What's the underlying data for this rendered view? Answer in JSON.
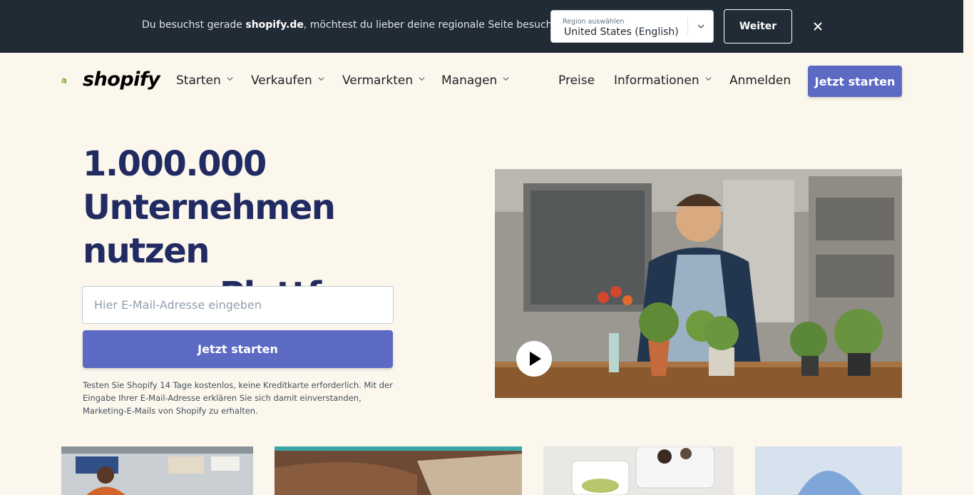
{
  "region_banner": {
    "text_before": "Du besuchst gerade ",
    "domain": "shopify.de",
    "text_after": ", möchtest du lieber deine regionale Seite besuchen?",
    "select_label": "Region auswählen",
    "select_value": "United States (English)",
    "continue_label": "Weiter",
    "close_icon": "close-icon"
  },
  "nav": {
    "logo_text": "shopify",
    "items": [
      {
        "label": "Starten",
        "dropdown": true
      },
      {
        "label": "Verkaufen",
        "dropdown": true
      },
      {
        "label": "Vermarkten",
        "dropdown": true
      },
      {
        "label": "Managen",
        "dropdown": true
      },
      {
        "label": "Preise",
        "dropdown": false
      },
      {
        "label": "Informationen",
        "dropdown": true
      },
      {
        "label": "Anmelden",
        "dropdown": false
      }
    ],
    "cta_label": "Jetzt starten"
  },
  "hero": {
    "title_line1": "1.000.000",
    "title_line2": "Unternehmen nutzen",
    "title_line3": "unsere Plattform",
    "email_placeholder": "Hier E-Mail-Adresse eingeben",
    "cta_label": "Jetzt starten",
    "fineprint": "Testen Sie Shopify 14 Tage kostenlos, keine Kreditkarte erforderlich. Mit der Eingabe Ihrer E-Mail-Adresse erklären Sie sich damit einverstanden, Marketing-E-Mails von Shopify zu erhalten.",
    "video_icon": "play-icon"
  },
  "colors": {
    "banner_bg": "#212b36",
    "page_bg": "#fbf7ed",
    "accent": "#5c6ac4",
    "heading": "#212b62"
  }
}
